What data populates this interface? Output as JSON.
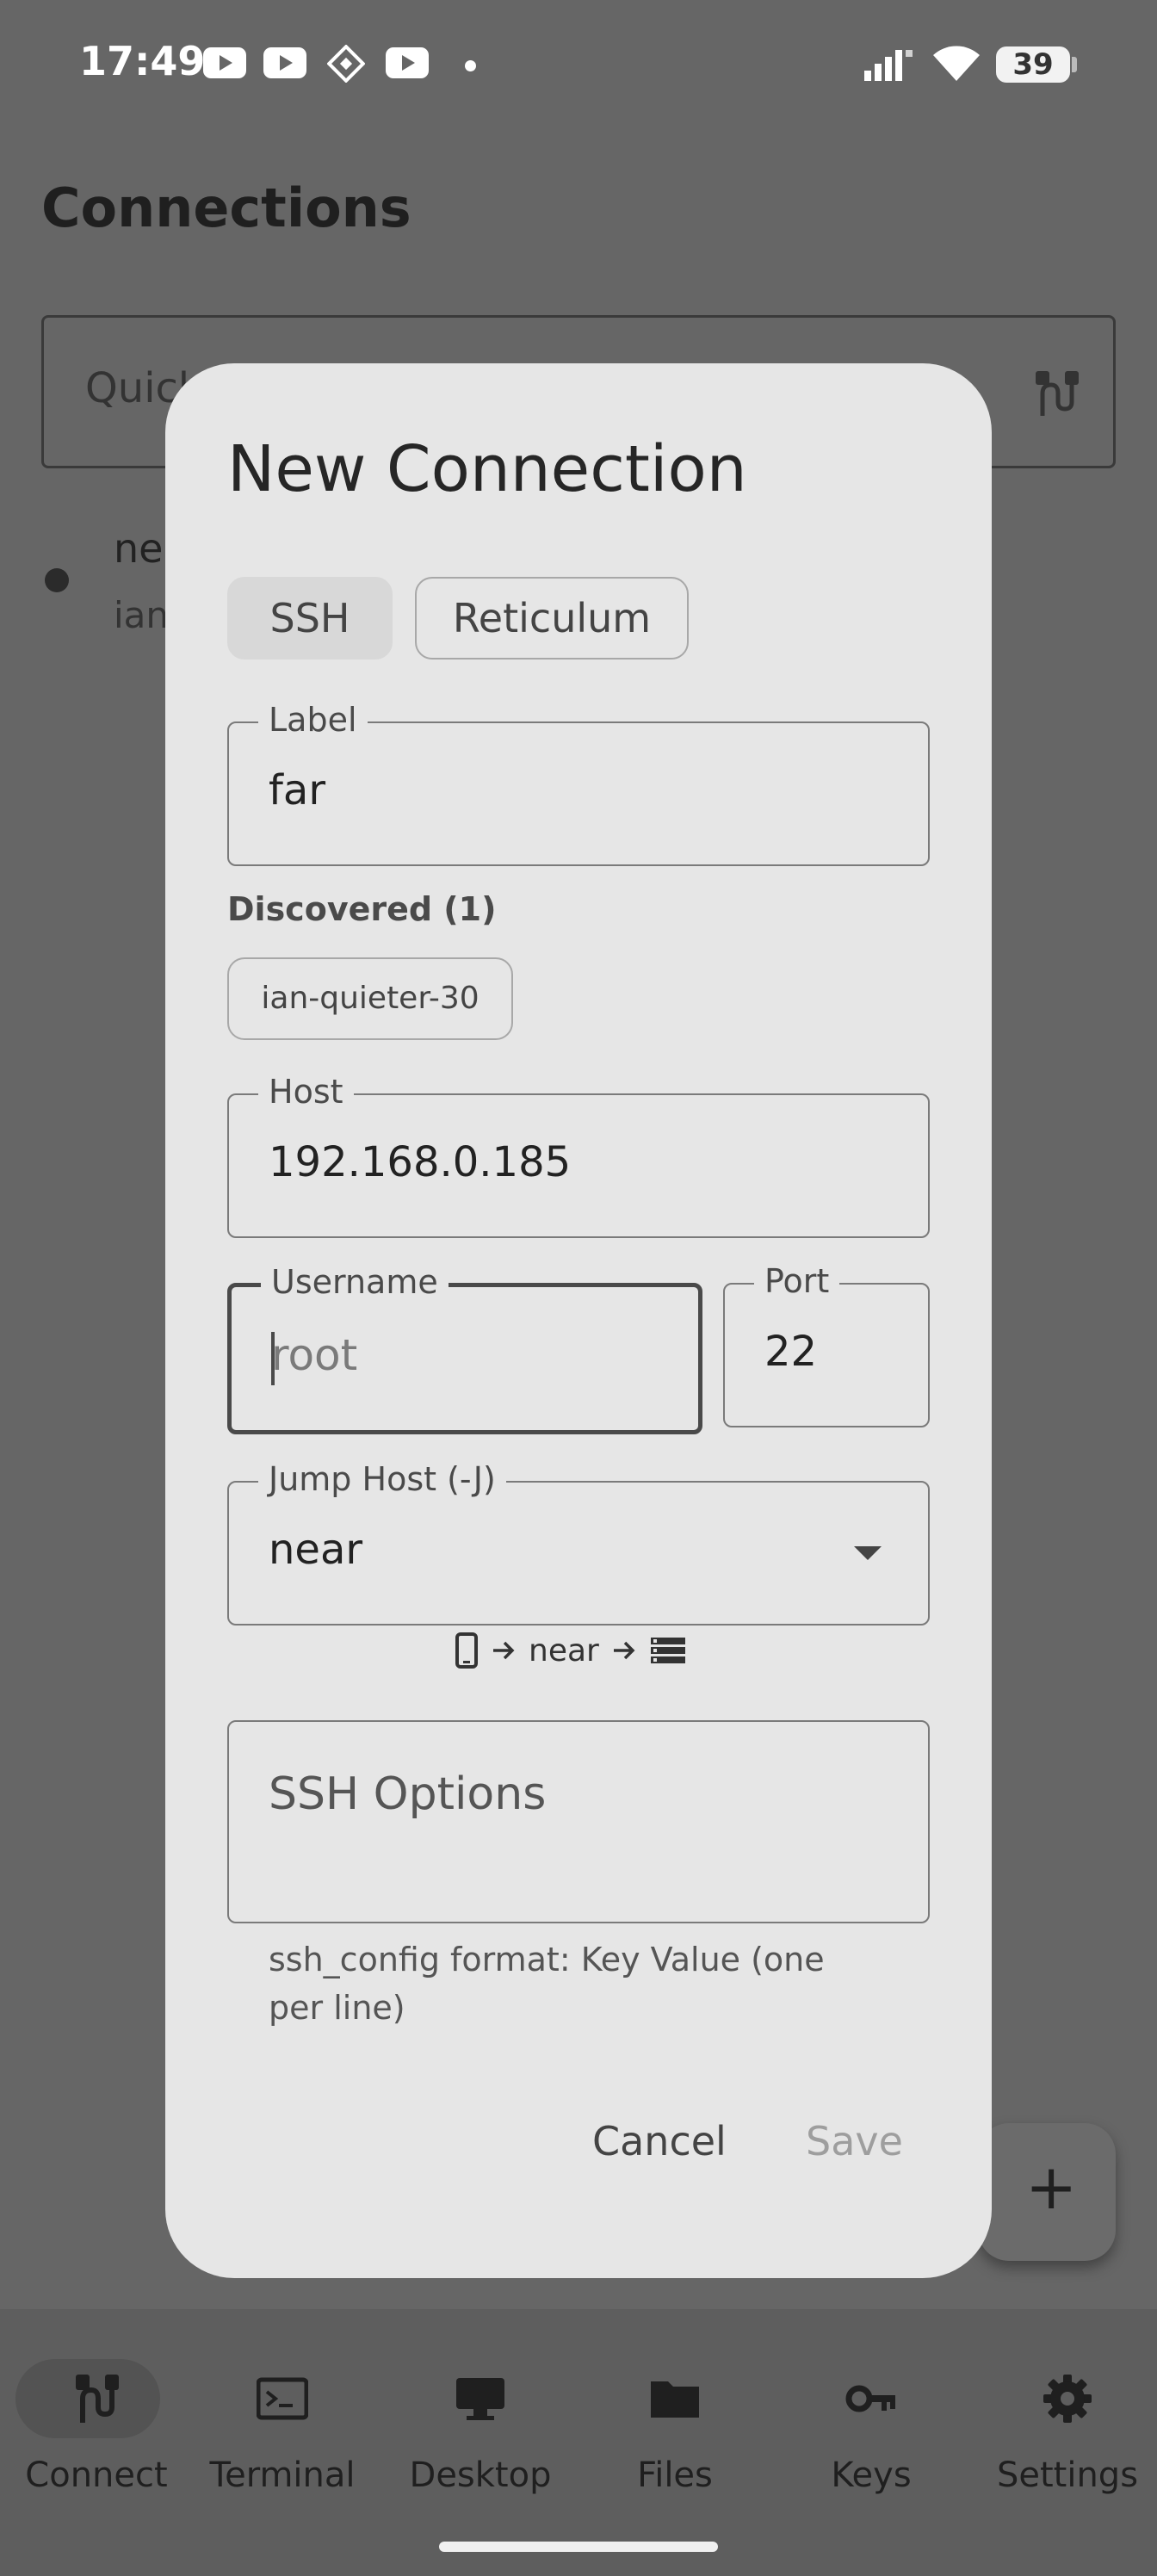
{
  "status_bar": {
    "time": "17:49",
    "notification_icons": [
      "youtube-icon",
      "youtube-icon",
      "app-icon",
      "youtube-icon",
      "dot-icon"
    ],
    "battery": "39"
  },
  "page": {
    "title": "Connections",
    "quick_connect_text": "Quick",
    "connection_name": "ne",
    "connection_sub": "ian"
  },
  "dialog": {
    "title": "New Connection",
    "tabs": [
      {
        "label": "SSH",
        "selected": true
      },
      {
        "label": "Reticulum",
        "selected": false
      }
    ],
    "label_field": {
      "label": "Label",
      "value": "far"
    },
    "discovered": {
      "heading": "Discovered (1)",
      "items": [
        "ian-quieter-30"
      ]
    },
    "host_field": {
      "label": "Host",
      "value": "192.168.0.185"
    },
    "username_field": {
      "label": "Username",
      "placeholder": "root"
    },
    "port_field": {
      "label": "Port",
      "value": "22"
    },
    "jump_field": {
      "label": "Jump Host (-J)",
      "value": "near"
    },
    "route": {
      "via": "near"
    },
    "ssh_options": {
      "placeholder": "SSH Options",
      "helper": "ssh_config format: Key Value (one per line)"
    },
    "cancel": "Cancel",
    "save": "Save"
  },
  "fab": {
    "icon": "plus-icon"
  },
  "bottom_nav": [
    {
      "label": "Connect",
      "icon": "cable-icon",
      "active": true
    },
    {
      "label": "Terminal",
      "icon": "terminal-icon",
      "active": false
    },
    {
      "label": "Desktop",
      "icon": "desktop-icon",
      "active": false
    },
    {
      "label": "Files",
      "icon": "folder-icon",
      "active": false
    },
    {
      "label": "Keys",
      "icon": "key-icon",
      "active": false
    },
    {
      "label": "Settings",
      "icon": "gear-icon",
      "active": false
    }
  ]
}
